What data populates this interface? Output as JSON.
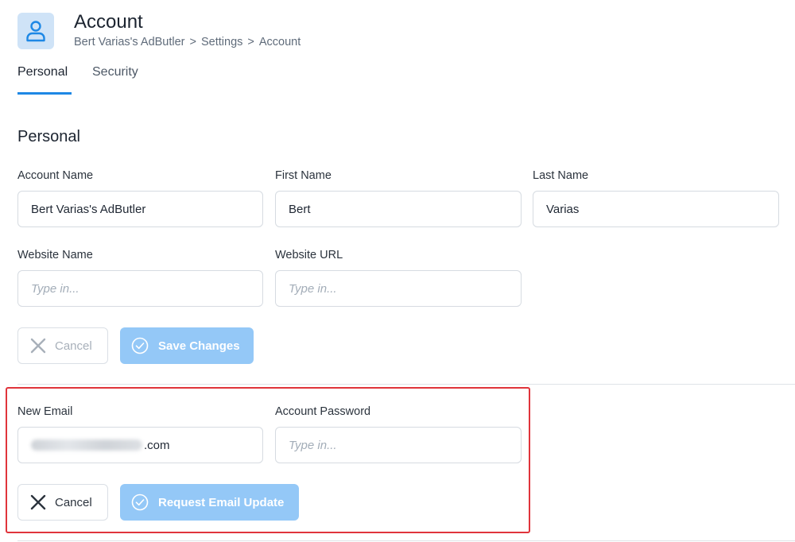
{
  "header": {
    "title": "Account",
    "breadcrumb": [
      "Bert Varias's AdButler",
      "Settings",
      "Account"
    ],
    "breadcrumb_separator": ">"
  },
  "tabs": [
    {
      "label": "Personal",
      "active": true
    },
    {
      "label": "Security",
      "active": false
    }
  ],
  "personal": {
    "section_title": "Personal",
    "account_name": {
      "label": "Account Name",
      "value": "Bert Varias's AdButler"
    },
    "first_name": {
      "label": "First Name",
      "value": "Bert"
    },
    "last_name": {
      "label": "Last Name",
      "value": "Varias"
    },
    "website_name": {
      "label": "Website Name",
      "placeholder": "Type in..."
    },
    "website_url": {
      "label": "Website URL",
      "placeholder": "Type in..."
    },
    "cancel_label": "Cancel",
    "save_label": "Save Changes"
  },
  "email_update": {
    "new_email": {
      "label": "New Email",
      "value_suffix": ".com"
    },
    "account_password": {
      "label": "Account Password",
      "placeholder": "Type in..."
    },
    "cancel_label": "Cancel",
    "request_label": "Request Email Update"
  },
  "colors": {
    "accent": "#1e88e5",
    "primary_button_disabled": "#94c8f7",
    "highlight": "#e0343b"
  }
}
